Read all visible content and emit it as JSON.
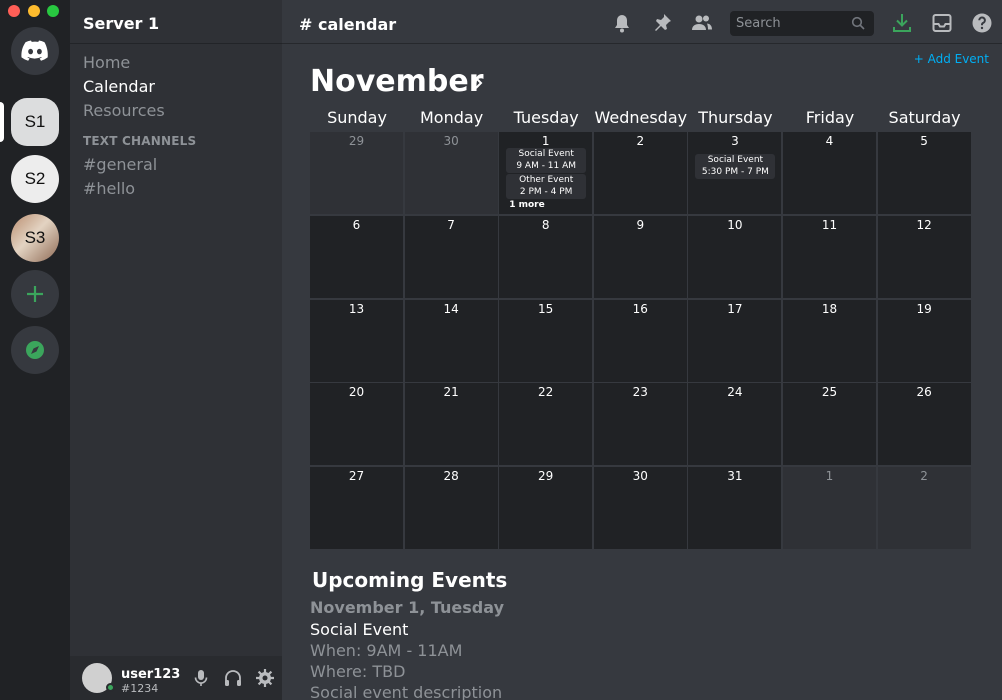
{
  "window": {
    "controls": [
      "close",
      "minimize",
      "maximize"
    ]
  },
  "servers": {
    "home_icon": "discord-logo-icon",
    "items": [
      {
        "label": "S1",
        "bg": "#dcddde"
      },
      {
        "label": "S2",
        "bg": "#ececec"
      },
      {
        "label": "S3",
        "bg": "#c9b19a"
      }
    ],
    "add_icon": "plus-icon",
    "explore_icon": "compass-icon"
  },
  "sidebar": {
    "server_name": "Server 1",
    "nav": [
      {
        "label": "Home",
        "active": false
      },
      {
        "label": "Calendar",
        "active": true
      },
      {
        "label": "Resources",
        "active": false
      }
    ],
    "text_channels_header": "TEXT CHANNELS",
    "channels": [
      "#general",
      "#hello"
    ],
    "user": {
      "name": "user123",
      "tag": "#1234",
      "status": "online"
    }
  },
  "header": {
    "channel_title": "# calendar",
    "search_placeholder": "Search",
    "icons": [
      "bell-icon",
      "pin-icon",
      "members-icon",
      "search-icon",
      "download-icon",
      "inbox-icon",
      "help-icon"
    ]
  },
  "calendar": {
    "add_event_label": "+ Add Event",
    "month": "November",
    "weekdays": [
      "Sunday",
      "Monday",
      "Tuesday",
      "Wednesday",
      "Thursday",
      "Friday",
      "Saturday"
    ],
    "weeks": [
      [
        "29",
        "30",
        "1",
        "2",
        "3",
        "4",
        "5"
      ],
      [
        "6",
        "7",
        "8",
        "9",
        "10",
        "11",
        "12"
      ],
      [
        "13",
        "14",
        "15",
        "16",
        "17",
        "18",
        "19"
      ],
      [
        "20",
        "21",
        "22",
        "23",
        "24",
        "25",
        "26"
      ],
      [
        "27",
        "28",
        "29",
        "30",
        "31",
        "1",
        "2"
      ]
    ],
    "dimmed": [
      [
        0,
        0
      ],
      [
        0,
        1
      ],
      [
        4,
        5
      ],
      [
        4,
        6
      ]
    ],
    "events": {
      "tue1": [
        {
          "title": "Social Event",
          "time": "9 AM - 11 AM"
        },
        {
          "title": "Other Event",
          "time": "2 PM - 4 PM"
        }
      ],
      "tue1_more": "1 more",
      "thu3": [
        {
          "title": "Social Event",
          "time": "5:30 PM - 7 PM"
        }
      ]
    }
  },
  "upcoming": {
    "title": "Upcoming Events",
    "date": "November 1, Tuesday",
    "event_name": "Social Event",
    "when": "When: 9AM - 11AM",
    "where": "Where: TBD",
    "description": "Social event description"
  },
  "colors": {
    "accent_green": "#3ba55c",
    "link_blue": "#00aff4",
    "blurple": "#5865f2"
  }
}
